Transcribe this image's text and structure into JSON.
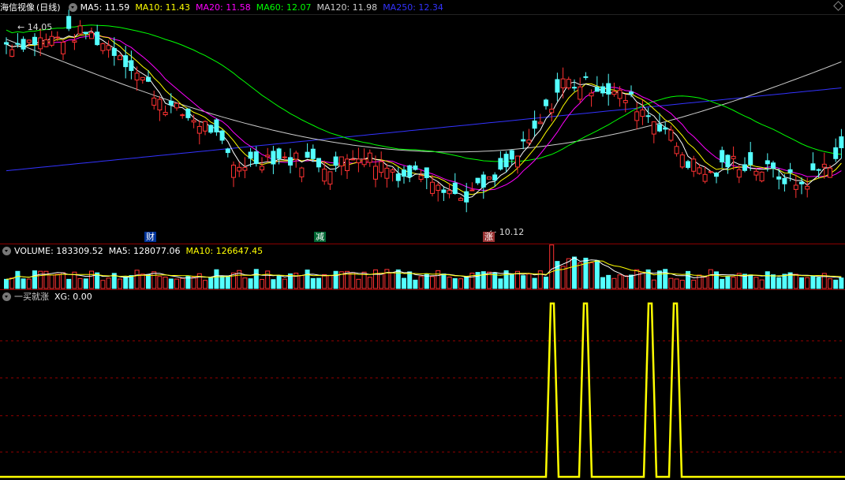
{
  "main_header": {
    "stock_name": "海信视像",
    "period": "(日线)",
    "indicators": [
      {
        "label": "MA5: 11.59",
        "color": "#ffffff"
      },
      {
        "label": "MA10: 11.43",
        "color": "#ffff00"
      },
      {
        "label": "MA20: 11.58",
        "color": "#ff00ff"
      },
      {
        "label": "MA60: 12.07",
        "color": "#00ff00"
      },
      {
        "label": "MA120: 11.98",
        "color": "#cccccc"
      },
      {
        "label": "MA250: 12.34",
        "color": "#3333ff"
      }
    ]
  },
  "price_labels": {
    "high": "14.05",
    "low": "10.12"
  },
  "events": [
    {
      "text": "财",
      "bg": "#003399",
      "fg": "#ffffff"
    },
    {
      "text": "减",
      "bg": "#006633",
      "fg": "#ffffff"
    },
    {
      "text": "涨",
      "bg": "#993333",
      "fg": "#ffffff"
    }
  ],
  "volume_header": {
    "title": "VOLUME: 183309.52",
    "ma5": "MA5: 128077.06",
    "ma10": "MA10: 126647.45"
  },
  "indicator_header": {
    "title": "一买就涨",
    "xg": "XG: 0.00"
  },
  "colors": {
    "up": "#ff3232",
    "down": "#54ffff",
    "ma5": "#ffffff",
    "ma10": "#ffff00",
    "ma20": "#ff00ff",
    "ma60": "#00ff00",
    "ma120": "#cccccc",
    "ma250": "#3333ff",
    "signal": "#ffff00",
    "divider": "#8b0000"
  },
  "signals": {
    "count": 4,
    "value": 1
  }
}
